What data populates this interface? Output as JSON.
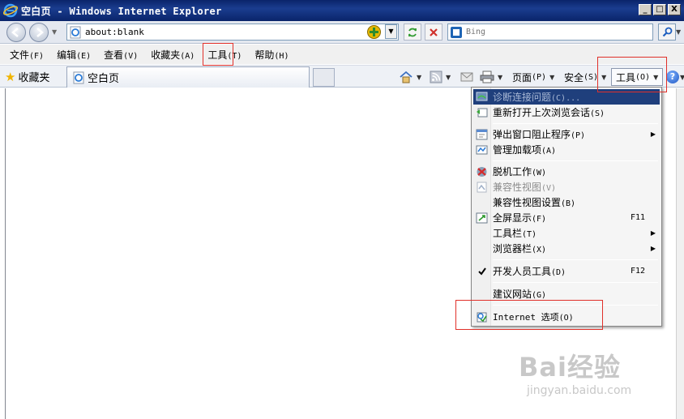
{
  "window": {
    "title": "空白页 - Windows Internet Explorer",
    "controls": [
      "_",
      "□",
      "X"
    ]
  },
  "address_bar": {
    "url": "about:blank"
  },
  "search": {
    "placeholder": "Bing"
  },
  "menubar": {
    "items": [
      {
        "label": "文件",
        "hotkey": "(F)"
      },
      {
        "label": "编辑",
        "hotkey": "(E)"
      },
      {
        "label": "查看",
        "hotkey": "(V)"
      },
      {
        "label": "收藏夹",
        "hotkey": "(A)"
      },
      {
        "label": "工具",
        "hotkey": "(T)"
      },
      {
        "label": "帮助",
        "hotkey": "(H)"
      }
    ]
  },
  "favorites": {
    "label": "收藏夹"
  },
  "tab": {
    "title": "空白页"
  },
  "commandbar": {
    "page": {
      "label": "页面",
      "hotkey": "(P)"
    },
    "safety": {
      "label": "安全",
      "hotkey": "(S)"
    },
    "tools": {
      "label": "工具",
      "hotkey": "(O)"
    }
  },
  "tools_menu": {
    "items": [
      {
        "label": "诊断连接问题",
        "hotkey": "(C)...",
        "state": "highlight-disabled"
      },
      {
        "label": "重新打开上次浏览会话",
        "hotkey": "(S)"
      },
      {
        "label": "弹出窗口阻止程序",
        "hotkey": "(P)",
        "submenu": true
      },
      {
        "label": "管理加载项",
        "hotkey": "(A)"
      },
      {
        "label": "脱机工作",
        "hotkey": "(W)"
      },
      {
        "label": "兼容性视图",
        "hotkey": "(V)",
        "state": "disabled"
      },
      {
        "label": "兼容性视图设置",
        "hotkey": "(B)"
      },
      {
        "label": "全屏显示",
        "hotkey": "(F)",
        "shortcut": "F11"
      },
      {
        "label": "工具栏",
        "hotkey": "(T)",
        "submenu": true
      },
      {
        "label": "浏览器栏",
        "hotkey": "(X)",
        "submenu": true
      },
      {
        "label": "开发人员工具",
        "hotkey": "(D)",
        "shortcut": "F12",
        "checked": true
      },
      {
        "label": "建议网站",
        "hotkey": "(G)"
      },
      {
        "label": "Internet 选项",
        "hotkey": "(O)"
      }
    ]
  },
  "watermark": {
    "main": "Bai经验",
    "sub": "jingyan.baidu.com"
  },
  "colors": {
    "titlebar": "#0a246a",
    "highlight": "#1f3f7c",
    "annotation": "#e0302a"
  }
}
